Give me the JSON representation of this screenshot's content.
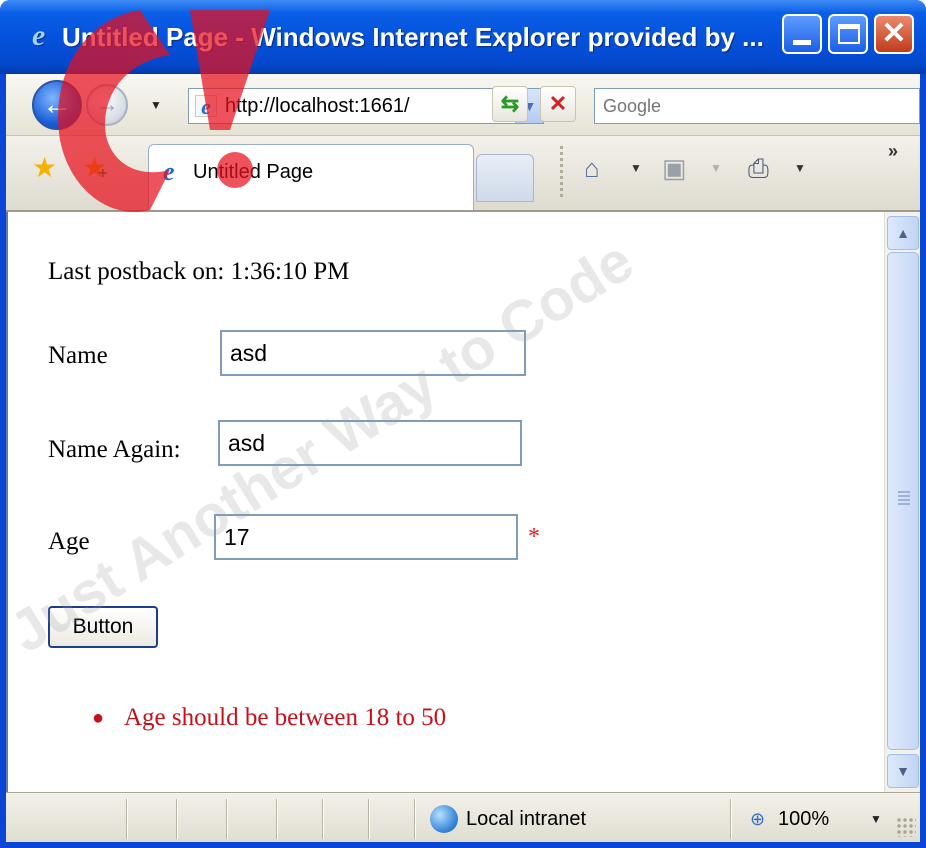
{
  "window": {
    "title": "Untitled Page - Windows Internet Explorer provided by ...",
    "minimize_icon": "minimize-icon",
    "maximize_icon": "maximize-icon",
    "close_icon": "close-icon"
  },
  "addressbar": {
    "url": "http://localhost:1661/",
    "search_placeholder": "Google"
  },
  "tabs": [
    {
      "label": "Untitled Page"
    }
  ],
  "page": {
    "postback_text": "Last postback on: 1:36:10 PM",
    "name_label": "Name",
    "name_value": "asd",
    "name_again_label": "Name Again:",
    "name_again_value": "asd",
    "age_label": "Age",
    "age_value": "17",
    "required_marker": "*",
    "button_label": "Button",
    "validation_summary": [
      "Age should be between 18 to 50"
    ]
  },
  "statusbar": {
    "zone": "Local intranet",
    "zoom": "100%"
  },
  "colors": {
    "titlebar": "#0552dc",
    "validation_error": "#c8101a",
    "required_marker": "#e0201a"
  },
  "watermark": {
    "text": "Just Another Way to Code"
  }
}
